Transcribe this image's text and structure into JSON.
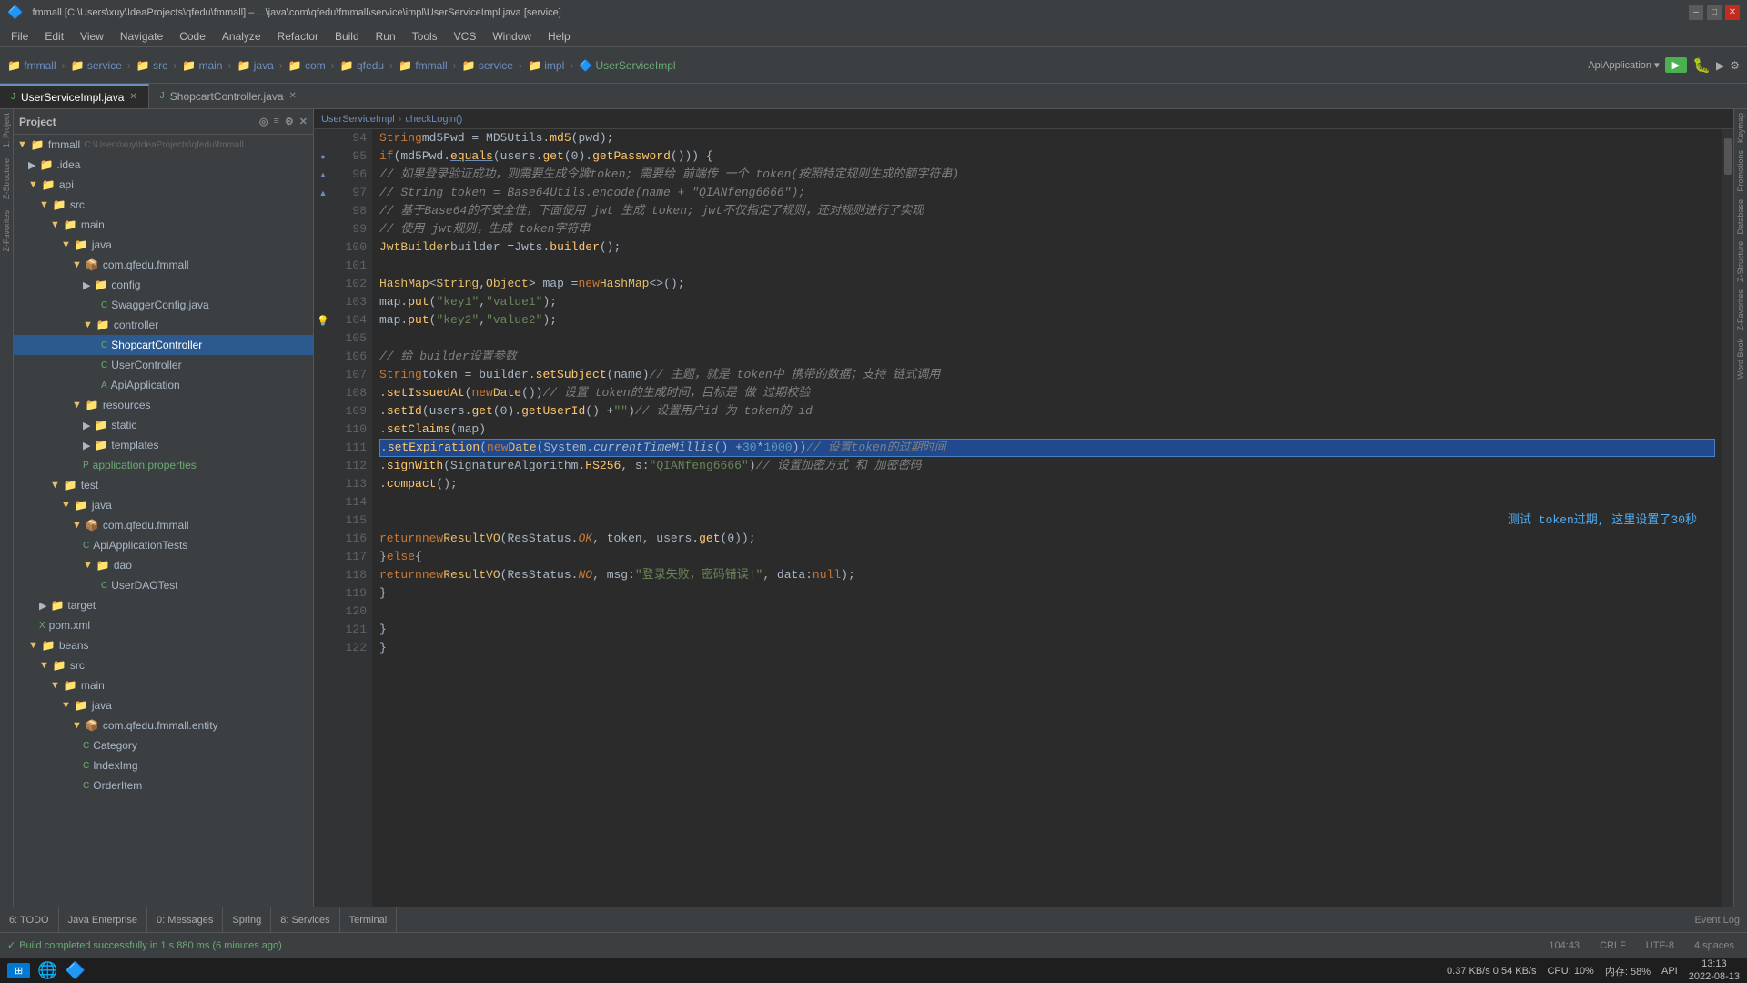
{
  "titlebar": {
    "title": "fmmall [C:\\Users\\xuy\\IdeaProjects\\qfedu\\fmmall] – ...\\java\\com\\qfedu\\fmmall\\service\\impl\\UserServiceImpl.java [service]",
    "window_controls": [
      "–",
      "□",
      "✕"
    ]
  },
  "menubar": {
    "items": [
      "File",
      "Edit",
      "View",
      "Navigate",
      "Code",
      "Analyze",
      "Refactor",
      "Build",
      "Run",
      "Tools",
      "VCS",
      "Window",
      "Help"
    ]
  },
  "toolbar": {
    "breadcrumbs": [
      "fmmall",
      "service",
      "src",
      "main",
      "java",
      "com",
      "qfedu",
      "fmmall",
      "service",
      "impl",
      "UserServiceImpl"
    ],
    "app_selector": "ApiApplication",
    "run_icon": "▶"
  },
  "tabs": [
    {
      "label": "UserServiceImpl.java",
      "active": true,
      "modified": false
    },
    {
      "label": "ShopcartController.java",
      "active": false,
      "modified": false
    }
  ],
  "breadcrumb_bar": {
    "items": [
      "UserServiceImpl",
      "checkLogin()"
    ]
  },
  "project_tree": {
    "header": "Project",
    "nodes": [
      {
        "indent": 0,
        "icon": "folder",
        "label": "fmmall",
        "path": "C:\\Users\\xuy\\IdeaProjects\\qfedu\\fmmall",
        "expanded": true
      },
      {
        "indent": 1,
        "icon": "folder",
        "label": ".idea",
        "expanded": false
      },
      {
        "indent": 1,
        "icon": "folder",
        "label": "api",
        "expanded": true
      },
      {
        "indent": 2,
        "icon": "folder",
        "label": "src",
        "expanded": true
      },
      {
        "indent": 3,
        "icon": "folder",
        "label": "main",
        "expanded": true
      },
      {
        "indent": 4,
        "icon": "folder",
        "label": "java",
        "expanded": true
      },
      {
        "indent": 5,
        "icon": "folder",
        "label": "com.qfedu.fmmall",
        "expanded": true
      },
      {
        "indent": 6,
        "icon": "folder",
        "label": "config",
        "expanded": false
      },
      {
        "indent": 7,
        "icon": "java",
        "label": "SwaggerConfig.java",
        "selected": false
      },
      {
        "indent": 6,
        "icon": "folder",
        "label": "controller",
        "expanded": true
      },
      {
        "indent": 7,
        "icon": "java",
        "label": "ShopcartController",
        "selected": true
      },
      {
        "indent": 7,
        "icon": "java",
        "label": "UserController",
        "selected": false
      },
      {
        "indent": 7,
        "icon": "java",
        "label": "ApiApplication",
        "selected": false
      },
      {
        "indent": 5,
        "icon": "folder",
        "label": "resources",
        "expanded": true
      },
      {
        "indent": 6,
        "icon": "folder",
        "label": "static",
        "expanded": false
      },
      {
        "indent": 6,
        "icon": "folder",
        "label": "templates",
        "expanded": false
      },
      {
        "indent": 6,
        "icon": "xml",
        "label": "application.properties",
        "selected": false
      },
      {
        "indent": 4,
        "icon": "folder",
        "label": "test",
        "expanded": true
      },
      {
        "indent": 5,
        "icon": "folder",
        "label": "java",
        "expanded": true
      },
      {
        "indent": 6,
        "icon": "folder",
        "label": "com.qfedu.fmmall",
        "expanded": true
      },
      {
        "indent": 7,
        "icon": "java",
        "label": "ApiApplicationTests",
        "selected": false
      },
      {
        "indent": 7,
        "icon": "folder",
        "label": "dao",
        "expanded": true
      },
      {
        "indent": 8,
        "icon": "java",
        "label": "UserDAOTest",
        "selected": false
      },
      {
        "indent": 3,
        "icon": "folder",
        "label": "target",
        "expanded": false
      },
      {
        "indent": 2,
        "icon": "xml",
        "label": "pom.xml",
        "selected": false
      },
      {
        "indent": 1,
        "icon": "folder",
        "label": "beans",
        "expanded": true
      },
      {
        "indent": 2,
        "icon": "folder",
        "label": "src",
        "expanded": true
      },
      {
        "indent": 3,
        "icon": "folder",
        "label": "main",
        "expanded": true
      },
      {
        "indent": 4,
        "icon": "folder",
        "label": "java",
        "expanded": true
      },
      {
        "indent": 5,
        "icon": "folder",
        "label": "com.qfedu.fmmall.entity",
        "expanded": true
      },
      {
        "indent": 6,
        "icon": "java",
        "label": "Category",
        "selected": false
      },
      {
        "indent": 6,
        "icon": "java",
        "label": "IndexImg",
        "selected": false
      },
      {
        "indent": 6,
        "icon": "java",
        "label": "OrderItem",
        "selected": false
      }
    ]
  },
  "editor": {
    "lines": [
      {
        "num": 94,
        "content": "        String md5Pwd = MD5Utils.md5(pwd);",
        "tokens": [
          {
            "text": "        String md5Pwd = MD5Utils.",
            "cls": "var"
          },
          {
            "text": "md5",
            "cls": "method"
          },
          {
            "text": "(pwd);",
            "cls": "var"
          }
        ]
      },
      {
        "num": 95,
        "content": "        if (md5Pwd.equals(users.get(0).getPassword())) {",
        "tokens": [
          {
            "text": "        ",
            "cls": ""
          },
          {
            "text": "if",
            "cls": "kw"
          },
          {
            "text": " (md5Pwd.",
            "cls": "var"
          },
          {
            "text": "equals",
            "cls": "fn"
          },
          {
            "text": "(users.",
            "cls": "var"
          },
          {
            "text": "get",
            "cls": "fn"
          },
          {
            "text": "(0).",
            "cls": "var"
          },
          {
            "text": "getPassword",
            "cls": "fn"
          },
          {
            "text": "())) {",
            "cls": "var"
          }
        ]
      },
      {
        "num": 96,
        "content": "            //",
        "gutter": "arrow-up"
      },
      {
        "num": 97,
        "content": "            //",
        "gutter": "arrow-up"
      },
      {
        "num": 98,
        "content": "            // 基于Base64的不安全性，下面使用 jwt 生成 token; jwt不仅指定了规则，还对规则进行了实现"
      },
      {
        "num": 99,
        "content": "            // 使用 jwt规则，生成 token字符串"
      },
      {
        "num": 100,
        "content": "            JwtBuilder builder = Jwts.builder();"
      },
      {
        "num": 101,
        "content": ""
      },
      {
        "num": 102,
        "content": "            HashMap<String, Object> map = new HashMap<>();"
      },
      {
        "num": 103,
        "content": "            map.put(\"key1\", \"value1\");"
      },
      {
        "num": 104,
        "content": "            map.put(\"key2\", \"value2\");",
        "gutter": "hint"
      },
      {
        "num": 105,
        "content": ""
      },
      {
        "num": 106,
        "content": "            // 给 builder设置参数"
      },
      {
        "num": 107,
        "content": "            String token = builder.setSubject(name) // 主题，就是 token中 携带的数据；支持 链式调用"
      },
      {
        "num": 108,
        "content": "                    .setIssuedAt(new Date()) // 设置 token的生成时间，目标是 做 过期校验"
      },
      {
        "num": 109,
        "content": "                    .setId(users.get(0).getUserId() + \"\") // 设置用户id 为 token的 id"
      },
      {
        "num": 110,
        "content": "                    .setClaims(map)"
      },
      {
        "num": 111,
        "content": "                    .setExpiration(new Date(System.currentTimeMillis() + 30 * 1000)) // 设置token的过期时间",
        "selected": true
      },
      {
        "num": 112,
        "content": "                    .signWith(SignatureAlgorithm.HS256,  s: \"QIANfeng6666\")// 设置加密方式 和 加密密码"
      },
      {
        "num": 113,
        "content": "                    .compact();"
      },
      {
        "num": 114,
        "content": ""
      },
      {
        "num": 115,
        "content": "            测试 token过期, 这里设置了30秒",
        "is_annotation": true
      },
      {
        "num": 116,
        "content": "            return new ResultVO(ResStatus.OK, token, users.get(0));"
      },
      {
        "num": 117,
        "content": "        } else {"
      },
      {
        "num": 118,
        "content": "            return new ResultVO(ResStatus.NO,  msg: \"登录失败，密码错误!\",  data: null);"
      },
      {
        "num": 119,
        "content": "        }"
      },
      {
        "num": 120,
        "content": ""
      },
      {
        "num": 121,
        "content": "        }"
      },
      {
        "num": 122,
        "content": "    }"
      }
    ]
  },
  "bottom_tabs": [
    {
      "label": "6: TODO",
      "active": false
    },
    {
      "label": "Java Enterprise",
      "active": false
    },
    {
      "label": "0: Messages",
      "active": false
    },
    {
      "label": "Spring",
      "active": false
    },
    {
      "label": "8: Services",
      "active": false
    },
    {
      "label": "Terminal",
      "active": false
    }
  ],
  "status_bar": {
    "message": "Build completed successfully in 1 s 880 ms (6 minutes ago)",
    "success": true,
    "position": "104:43",
    "line_ending": "CRLF",
    "encoding": "UTF-8",
    "indent": "4 spaces"
  },
  "system_bar": {
    "network": "0.37 KB/s 0.54 KB/s",
    "cpu": "CPU: 10%",
    "memory": "内存: 58%",
    "label": "API",
    "time": "13:13",
    "date": "2022-08-13"
  },
  "sidebar_right_labels": [
    "Keymap",
    "Promotions",
    "Database",
    "Z-Structure",
    "Z-Favorites",
    "Word Book"
  ]
}
